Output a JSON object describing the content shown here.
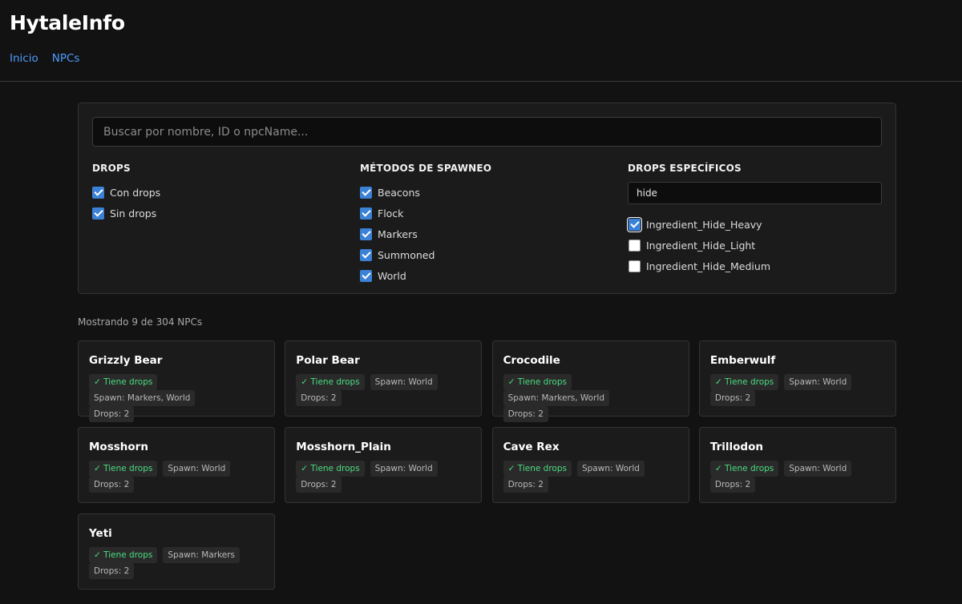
{
  "header": {
    "title": "HytaleInfo",
    "nav": [
      {
        "label": "Inicio"
      },
      {
        "label": "NPCs"
      }
    ]
  },
  "filters": {
    "search_placeholder": "Buscar por nombre, ID o npcName...",
    "drops": {
      "heading": "DROPS",
      "options": [
        {
          "label": "Con drops",
          "checked": true
        },
        {
          "label": "Sin drops",
          "checked": true
        }
      ]
    },
    "spawn": {
      "heading": "MÉTODOS DE SPAWNEO",
      "options": [
        {
          "label": "Beacons",
          "checked": true
        },
        {
          "label": "Flock",
          "checked": true
        },
        {
          "label": "Markers",
          "checked": true
        },
        {
          "label": "Summoned",
          "checked": true
        },
        {
          "label": "World",
          "checked": true
        }
      ]
    },
    "specific_drops": {
      "heading": "DROPS ESPECÍFICOS",
      "search_value": "hide",
      "options": [
        {
          "label": "Ingredient_Hide_Heavy",
          "checked": true
        },
        {
          "label": "Ingredient_Hide_Light",
          "checked": false
        },
        {
          "label": "Ingredient_Hide_Medium",
          "checked": false
        }
      ]
    }
  },
  "results": {
    "count_text": "Mostrando 9 de 304 NPCs",
    "npcs": [
      {
        "name": "Grizzly Bear",
        "drops_badge": "✓ Tiene drops",
        "spawn": "Spawn: Markers, World",
        "drop_count": "Drops: 2"
      },
      {
        "name": "Polar Bear",
        "drops_badge": "✓ Tiene drops",
        "spawn": "Spawn: World",
        "drop_count": "Drops: 2"
      },
      {
        "name": "Crocodile",
        "drops_badge": "✓ Tiene drops",
        "spawn": "Spawn: Markers, World",
        "drop_count": "Drops: 2"
      },
      {
        "name": "Emberwulf",
        "drops_badge": "✓ Tiene drops",
        "spawn": "Spawn: World",
        "drop_count": "Drops: 2"
      },
      {
        "name": "Mosshorn",
        "drops_badge": "✓ Tiene drops",
        "spawn": "Spawn: World",
        "drop_count": "Drops: 2"
      },
      {
        "name": "Mosshorn_Plain",
        "drops_badge": "✓ Tiene drops",
        "spawn": "Spawn: World",
        "drop_count": "Drops: 2"
      },
      {
        "name": "Cave Rex",
        "drops_badge": "✓ Tiene drops",
        "spawn": "Spawn: World",
        "drop_count": "Drops: 2"
      },
      {
        "name": "Trillodon",
        "drops_badge": "✓ Tiene drops",
        "spawn": "Spawn: World",
        "drop_count": "Drops: 2"
      },
      {
        "name": "Yeti",
        "drops_badge": "✓ Tiene drops",
        "spawn": "Spawn: Markers",
        "drop_count": "Drops: 2"
      }
    ]
  },
  "colors": {
    "link": "#4d9cff",
    "checkbox_checked": "#3b82d6",
    "drops_badge_text": "#4ade80",
    "background": "#121212",
    "panel": "#1b1b1b"
  }
}
